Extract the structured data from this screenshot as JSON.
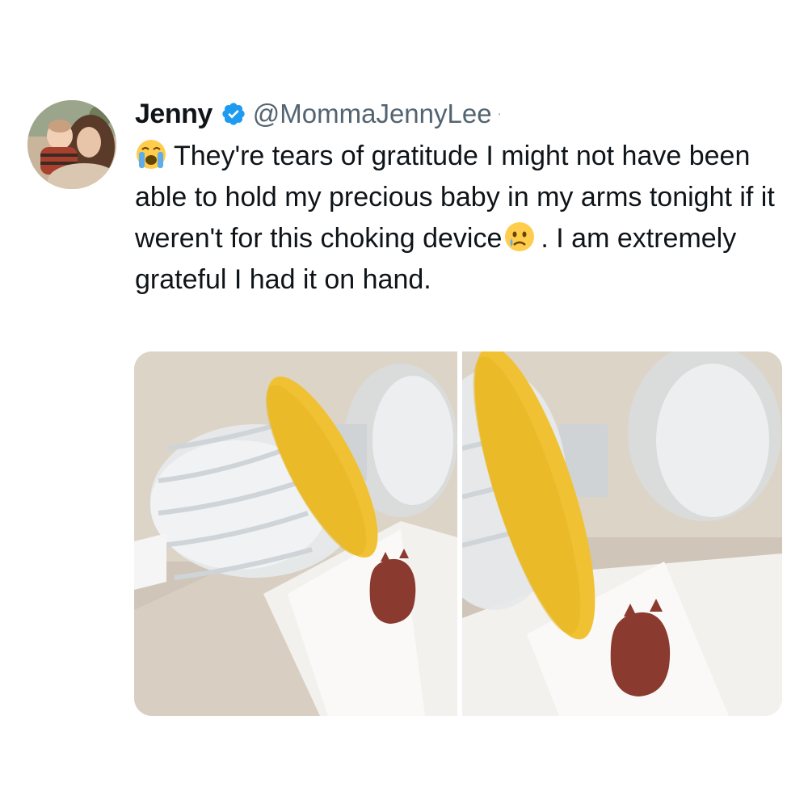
{
  "tweet": {
    "display_name": "Jenny",
    "handle": "@MommaJennyLee",
    "separator": "·",
    "text_part1": "They're tears of gratitude I might not have been able to hold my precious baby in my arms tonight if it weren't for this choking device",
    "text_part2": ". I am extremely grateful I had it on hand.",
    "emoji_1": "loudly-crying-face",
    "emoji_2": "crying-face"
  },
  "media": {
    "count": 2,
    "items": [
      "photo-choking-device-1",
      "photo-choking-device-2"
    ]
  },
  "colors": {
    "verified_blue": "#1d9bf0",
    "handle_gray": "#536471",
    "text": "#0f1419",
    "device_yellow": "#f0c233"
  }
}
